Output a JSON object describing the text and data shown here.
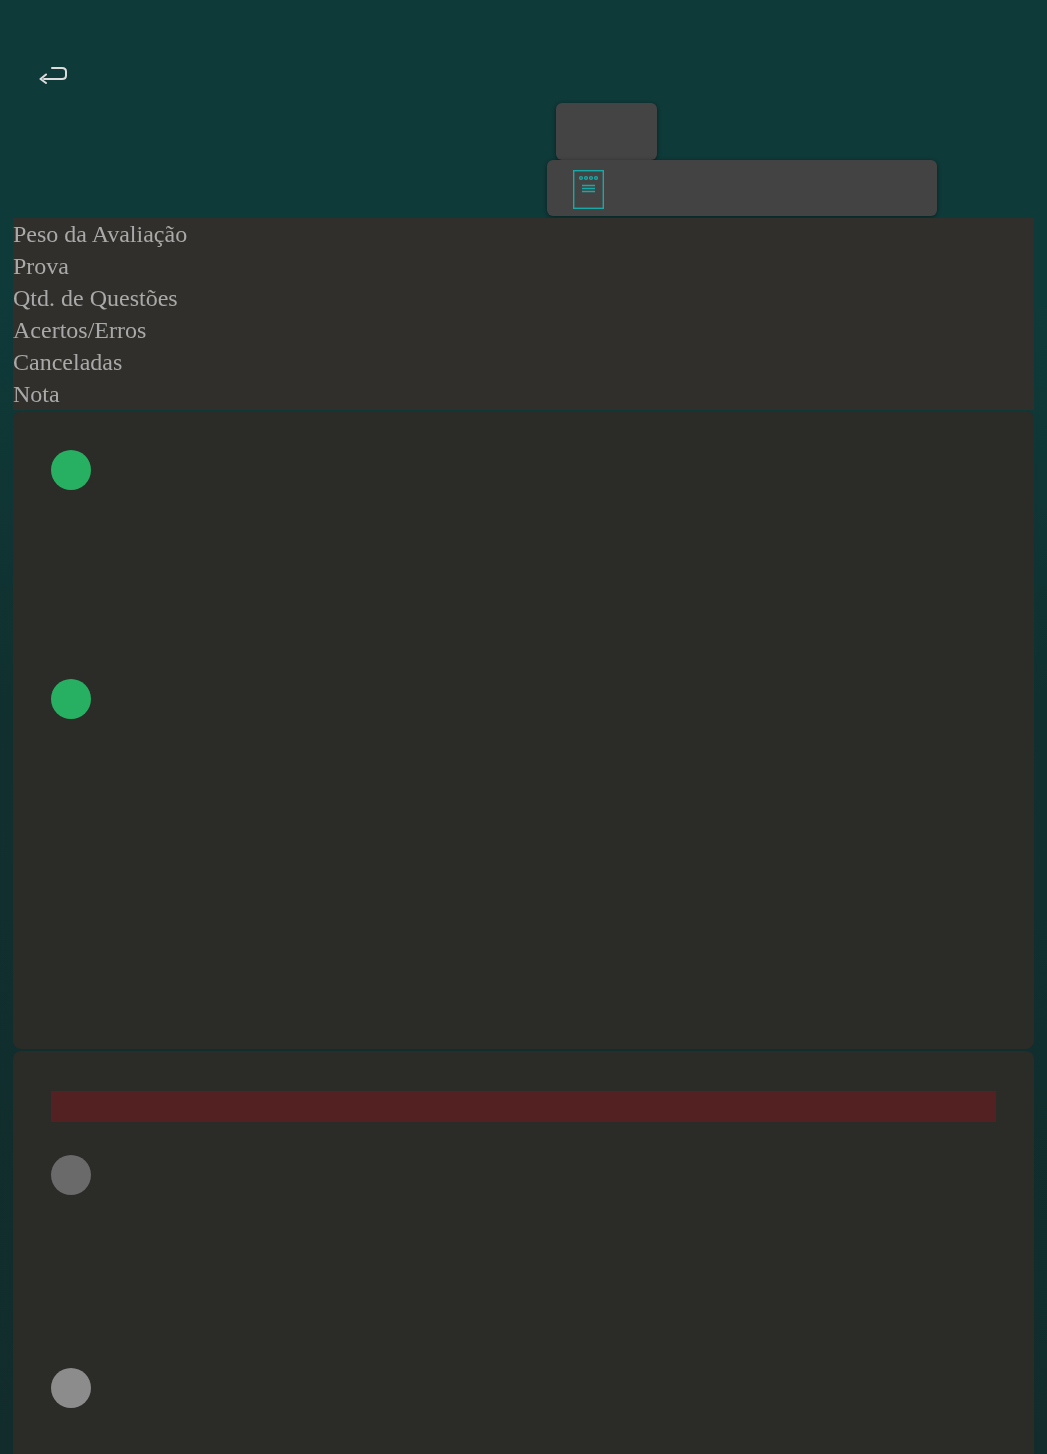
{
  "summary": {
    "labels": [
      "Peso da Avaliação",
      "Prova",
      "Qtd. de Questões",
      "Acertos/Erros",
      "Canceladas",
      "Nota"
    ]
  },
  "cards": [
    {
      "alert": false,
      "items": [
        {
          "color": "#27b062"
        },
        {
          "color": "#27b062"
        }
      ]
    },
    {
      "alert": true,
      "items": [
        {
          "color": "#6a6a6a"
        },
        {
          "color": "#8c8c8c"
        }
      ]
    }
  ]
}
